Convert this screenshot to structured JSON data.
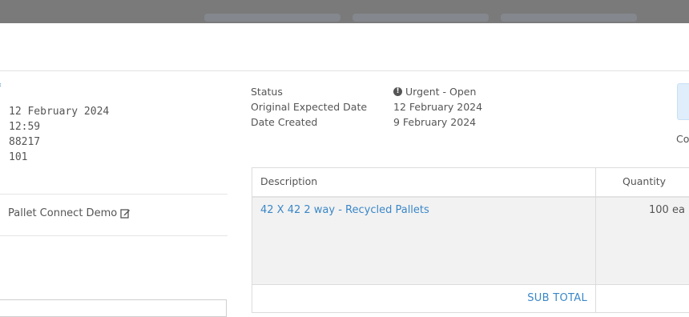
{
  "left": {
    "date": "12 February 2024",
    "time": "12:59",
    "ref_number": "88217",
    "code": "101",
    "supplier_name": "Pallet Connect Demo"
  },
  "status": {
    "labels": [
      "Status",
      "Original Expected Date",
      "Date Created"
    ],
    "status_value": "Urgent - Open",
    "expected_date": "12 February 2024",
    "date_created": "9 February 2024"
  },
  "right": {
    "co_text": "Co"
  },
  "table": {
    "headers": {
      "description": "Description",
      "quantity": "Quantity"
    },
    "rows": [
      {
        "description": "42 X 42 2 way - Recycled Pallets",
        "quantity": "100 ea"
      }
    ],
    "subtotal_label": "SUB TOTAL"
  },
  "colors": {
    "link": "#3a87c8",
    "overlay": "#7a7a7a",
    "row_bg": "#f2f2f2"
  },
  "icons": {
    "edit": "edit-icon",
    "urgent": "exclamation-circle-icon"
  }
}
